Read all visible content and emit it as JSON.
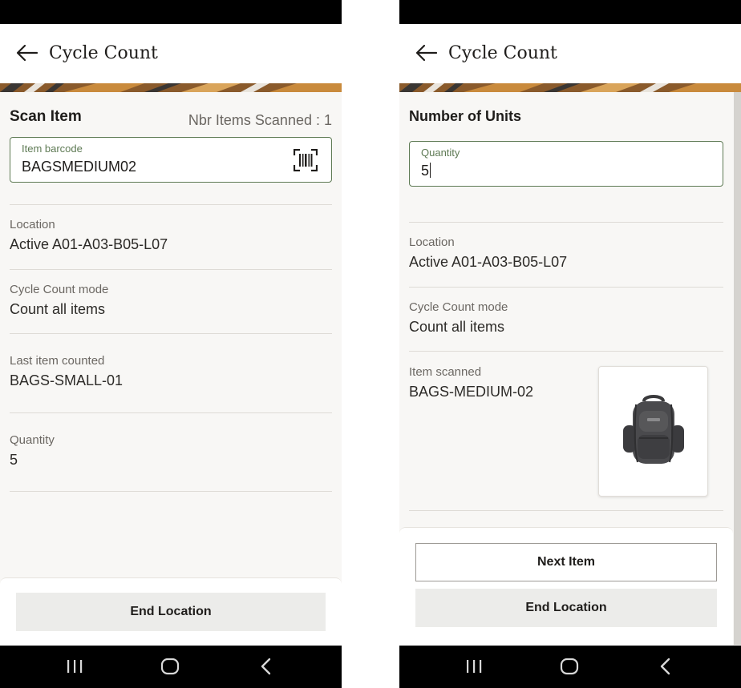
{
  "colors": {
    "accent_green": "#5e7a54",
    "background": "#f8f7f5",
    "system_bar": "#000000",
    "secondary_button": "#ececea"
  },
  "left_screen": {
    "header": {
      "title": "Cycle Count",
      "back_icon": "arrow-left-icon"
    },
    "section_title": "Scan Item",
    "scan_count": "Nbr Items Scanned : 1",
    "barcode_field": {
      "label": "Item barcode",
      "value": "BAGSMEDIUM02",
      "icon": "barcode-icon"
    },
    "info": [
      {
        "label": "Location",
        "value": "Active A01-A03-B05-L07"
      },
      {
        "label": "Cycle Count mode",
        "value": "Count all items"
      },
      {
        "label": "Last item counted",
        "value": "BAGS-SMALL-01"
      },
      {
        "label": "Quantity",
        "value": "5"
      }
    ],
    "buttons": {
      "end_location": "End Location"
    }
  },
  "right_screen": {
    "header": {
      "title": "Cycle Count",
      "back_icon": "arrow-left-icon"
    },
    "section_title": "Number of Units",
    "quantity_field": {
      "label": "Quantity",
      "value": "5"
    },
    "info": [
      {
        "label": "Location",
        "value": "Active A01-A03-B05-L07"
      },
      {
        "label": "Cycle Count mode",
        "value": "Count all items"
      },
      {
        "label": "Item scanned",
        "value": "BAGS-MEDIUM-02"
      }
    ],
    "item_image": "backpack-image",
    "buttons": {
      "next_item": "Next Item",
      "end_location": "End Location"
    }
  },
  "navigation": {
    "icons": [
      "recent-apps-icon",
      "home-icon",
      "back-icon"
    ]
  }
}
